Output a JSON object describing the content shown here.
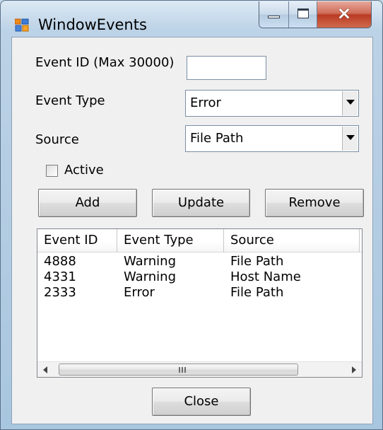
{
  "window": {
    "title": "WindowEvents"
  },
  "form": {
    "event_id_label": "Event ID (Max 30000)",
    "event_id_value": "",
    "event_type_label": "Event Type",
    "event_type_value": "Error",
    "source_label": "Source",
    "source_value": "File Path",
    "active_label": "Active",
    "active_checked": false
  },
  "buttons": {
    "add": "Add",
    "update": "Update",
    "remove": "Remove",
    "close": "Close"
  },
  "list": {
    "columns": [
      "Event ID",
      "Event Type",
      "Source"
    ],
    "rows": [
      [
        "4888",
        "Warning",
        "File Path"
      ],
      [
        "4331",
        "Warning",
        "Host Name"
      ],
      [
        "2333",
        "Error",
        "File Path"
      ]
    ],
    "scrollbar_grip": "III"
  },
  "icons": {
    "app_icon": "window-events-icon",
    "minimize": "minimize-icon",
    "maximize": "maximize-icon",
    "close": "close-icon",
    "dropdown": "chevron-down-icon",
    "scroll_left": "arrow-left-icon",
    "scroll_right": "arrow-right-icon"
  },
  "colors": {
    "window_frame": "#a8c6df",
    "client_background": "#f0f0f0",
    "close_button": "#c94a32"
  }
}
